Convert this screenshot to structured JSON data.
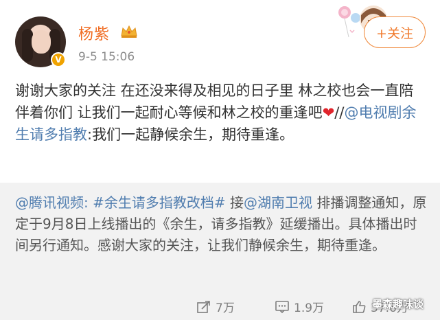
{
  "user": {
    "name": "杨紫",
    "timestamp": "9-5 15:06",
    "verified_icon": "verified-v-icon",
    "vip_icon": "crown-icon"
  },
  "follow_button": {
    "label": "+关注"
  },
  "post": {
    "text_main": "谢谢大家的关注 在还没来得及相见的日子里 林之校也会一直陪伴着你们 让我们一起耐心等候和林之校的重逢吧",
    "heart": "❤",
    "separator": "//",
    "mention": "@电视剧余生请多指教",
    "text_tail": ":我们一起静候余生，期待重逢。"
  },
  "repost": {
    "mention1": "@腾讯视频:",
    "hashtag": "#余生请多指教改档#",
    "word_jie": " 接",
    "mention2": "@湖南卫视",
    "body": " 排播调整通知，原定于9月8日上线播出的《余生，请多指教》延缓播出。具体播出时间另行通知。感谢大家的关注，让我们静候余生，期待重逢。"
  },
  "actions": {
    "repost_count": "7万",
    "comment_count": "1.9万",
    "like_count": "37.6万"
  },
  "watermark": "墨森趣味谈"
}
